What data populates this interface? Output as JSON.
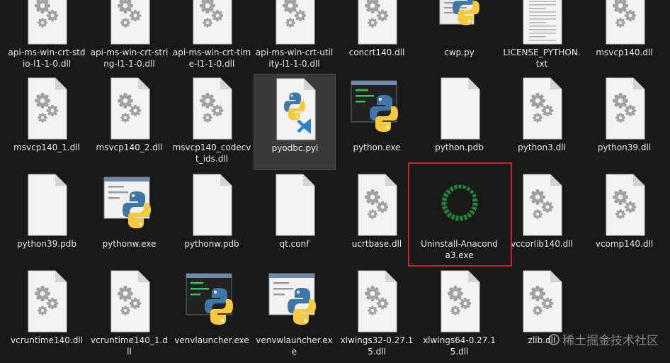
{
  "files": [
    {
      "label": "api-ms-win-crt-stdio-l1-1-0.dll",
      "icon": "dll-gear-icon"
    },
    {
      "label": "api-ms-win-crt-string-l1-1-0.dll",
      "icon": "dll-gear-icon"
    },
    {
      "label": "api-ms-win-crt-time-l1-1-0.dll",
      "icon": "dll-gear-icon"
    },
    {
      "label": "api-ms-win-crt-utility-l1-1-0.dll",
      "icon": "dll-gear-icon"
    },
    {
      "label": "concrt140.dll",
      "icon": "dll-gear-icon"
    },
    {
      "label": "cwp.py",
      "icon": "python-script-icon"
    },
    {
      "label": "LICENSE_PYTHON.txt",
      "icon": "text-file-icon"
    },
    {
      "label": "msvcp140.dll",
      "icon": "dll-gear-icon"
    },
    {
      "label": "msvcp140_1.dll",
      "icon": "dll-gear-icon"
    },
    {
      "label": "msvcp140_2.dll",
      "icon": "dll-gear-icon"
    },
    {
      "label": "msvcp140_codecvt_ids.dll",
      "icon": "dll-gear-icon"
    },
    {
      "label": "pyodbc.pyi",
      "icon": "vscode-python-file-icon",
      "selected": true
    },
    {
      "label": "python.exe",
      "icon": "python-console-exe-icon"
    },
    {
      "label": "python.pdb",
      "icon": "blank-file-icon"
    },
    {
      "label": "python3.dll",
      "icon": "dll-gear-icon"
    },
    {
      "label": "python39.dll",
      "icon": "dll-gear-icon"
    },
    {
      "label": "python39.pdb",
      "icon": "blank-file-icon"
    },
    {
      "label": "pythonw.exe",
      "icon": "python-window-exe-icon"
    },
    {
      "label": "pythonw.pdb",
      "icon": "blank-file-icon"
    },
    {
      "label": "qt.conf",
      "icon": "blank-file-icon"
    },
    {
      "label": "ucrtbase.dll",
      "icon": "dll-gear-icon"
    },
    {
      "label": "Uninstall-Anaconda3.exe",
      "icon": "anaconda-ring-icon"
    },
    {
      "label": "vccorlib140.dll",
      "icon": "dll-gear-icon"
    },
    {
      "label": "vcomp140.dll",
      "icon": "dll-gear-icon"
    },
    {
      "label": "vcruntime140.dll",
      "icon": "dll-gear-icon"
    },
    {
      "label": "vcruntime140_1.dll",
      "icon": "dll-gear-icon"
    },
    {
      "label": "venvlauncher.exe",
      "icon": "python-console-exe-icon"
    },
    {
      "label": "venvwlauncher.exe",
      "icon": "python-window-exe-icon"
    },
    {
      "label": "xlwings32-0.27.15.dll",
      "icon": "dll-gear-icon"
    },
    {
      "label": "xlwings64-0.27.15.dll",
      "icon": "dll-gear-icon"
    },
    {
      "label": "zlib.dll",
      "icon": "dll-gear-icon"
    }
  ],
  "watermark": "稀土掘金技术社区",
  "colors": {
    "background": "#191919",
    "highlight_border": "#c8262b",
    "anaconda_green": "#1f8a3b",
    "python_blue": "#3f76a8",
    "python_yellow": "#f7c93e"
  }
}
